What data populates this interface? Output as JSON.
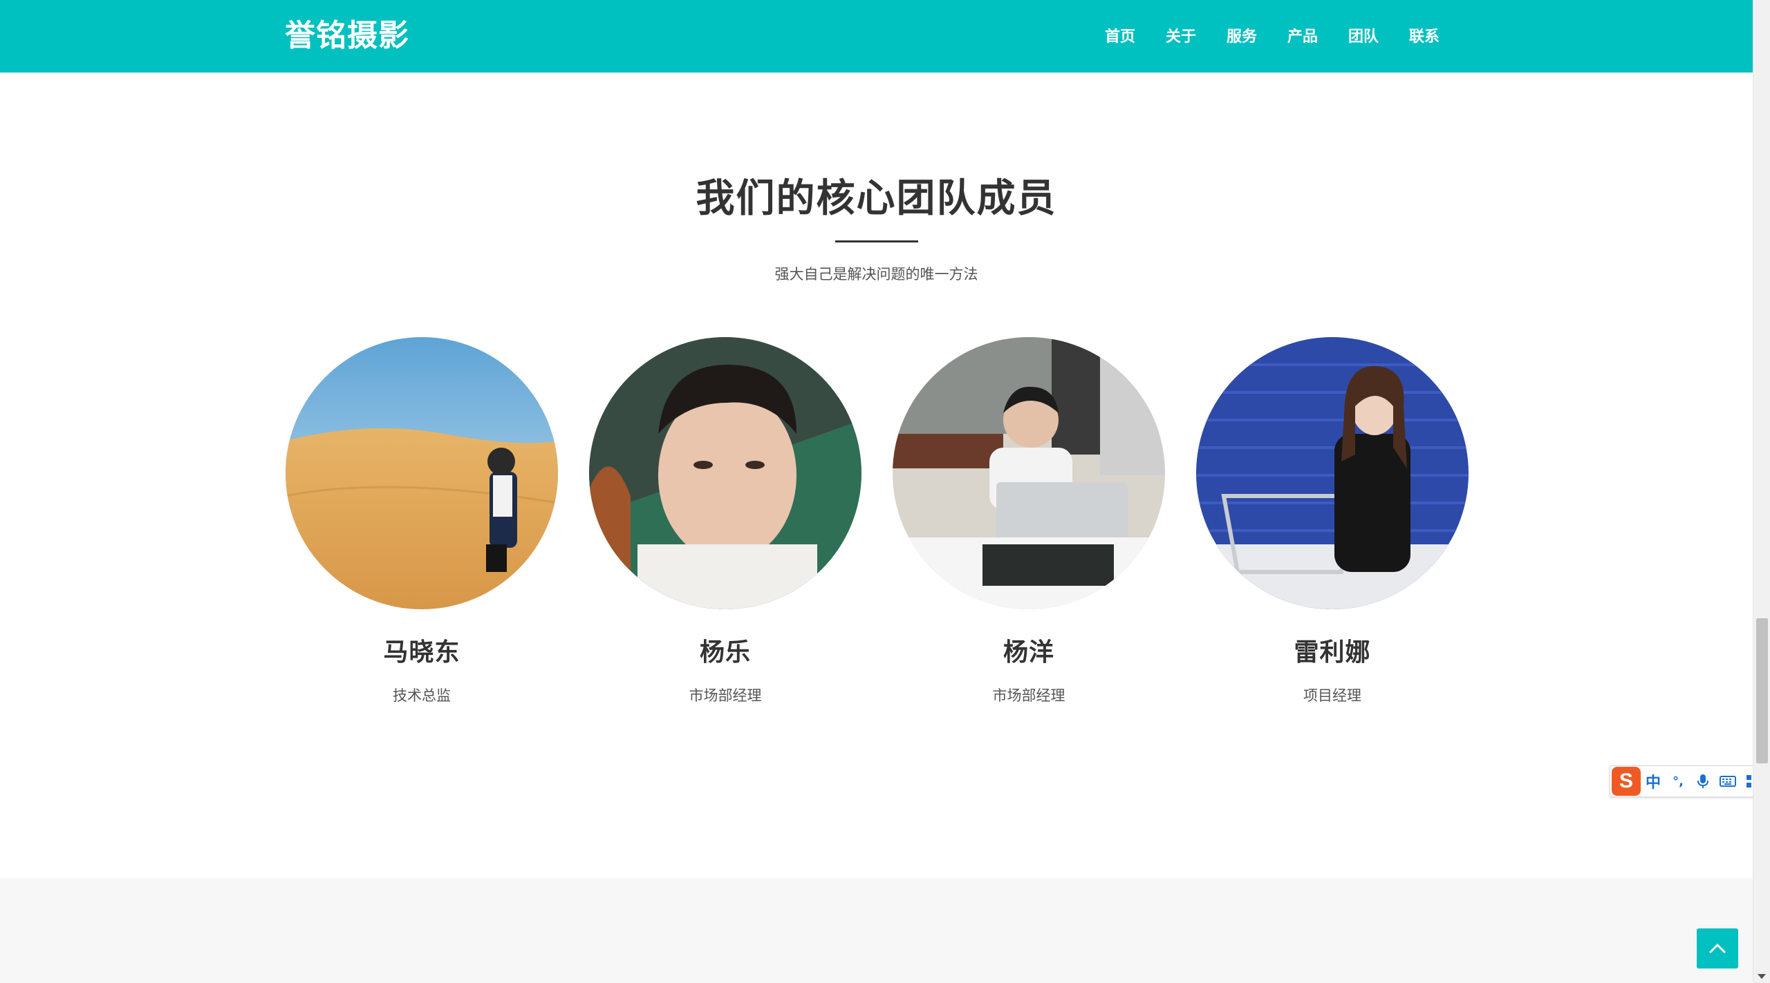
{
  "brand": {
    "name": "誉铭摄影"
  },
  "nav": {
    "items": [
      {
        "label": "首页"
      },
      {
        "label": "关于"
      },
      {
        "label": "服务"
      },
      {
        "label": "产品"
      },
      {
        "label": "团队"
      },
      {
        "label": "联系"
      }
    ]
  },
  "team_section": {
    "title": "我们的核心团队成员",
    "subtitle": "强大自己是解决问题的唯一方法",
    "members": [
      {
        "name": "马晓东",
        "role": "技术总监",
        "photo": "desert-portrait"
      },
      {
        "name": "杨乐",
        "role": "市场部经理",
        "photo": "selfie-portrait"
      },
      {
        "name": "杨洋",
        "role": "市场部经理",
        "photo": "laptop-portrait"
      },
      {
        "name": "雷利娜",
        "role": "项目经理",
        "photo": "shopping-cart-portrait"
      }
    ]
  },
  "ime_toolbar": {
    "logo": "S",
    "mode": "中",
    "punct": "°,",
    "icons": [
      "microphone-icon",
      "keyboard-icon",
      "grid-icon"
    ]
  },
  "colors": {
    "accent": "#00c0c0",
    "text": "#333333",
    "footer_bg": "#f7f7f7",
    "ime_orange": "#ef5a24"
  }
}
